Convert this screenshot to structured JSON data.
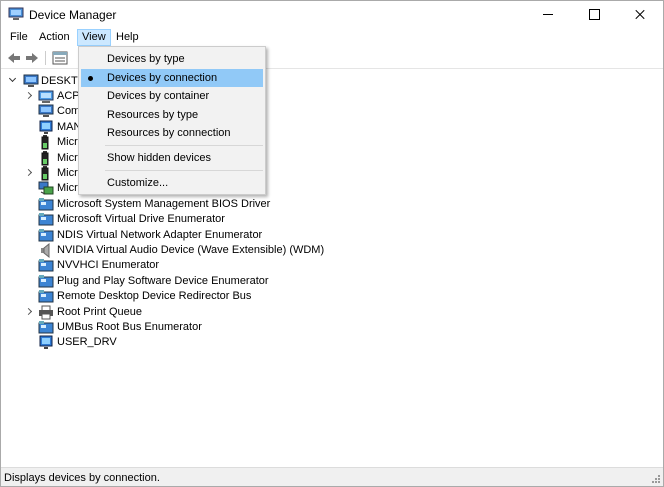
{
  "window": {
    "title": "Device Manager",
    "accent": "#cce8ff"
  },
  "menubar": {
    "file": "File",
    "action": "Action",
    "view": "View",
    "help": "Help"
  },
  "toolbar": {
    "back_icon": "arrow-left-icon",
    "forward_icon": "arrow-right-icon",
    "properties_icon": "properties-icon"
  },
  "tree": {
    "root": "DESKTO",
    "items": [
      {
        "label": "ACP",
        "icon": "acpi-icon",
        "expander": "collapsed"
      },
      {
        "label": "Com",
        "icon": "computer-icon",
        "expander": "none"
      },
      {
        "label": "MAN",
        "icon": "monitor-icon",
        "expander": "none"
      },
      {
        "label": "Micr",
        "icon": "battery-icon",
        "expander": "none"
      },
      {
        "label": "Micr",
        "icon": "battery-icon",
        "expander": "none"
      },
      {
        "label": "Micr",
        "icon": "battery-icon",
        "expander": "collapsed"
      },
      {
        "label": "Micr",
        "icon": "network-icon",
        "expander": "none"
      },
      {
        "label": "Microsoft System Management BIOS Driver",
        "icon": "system-device-icon",
        "expander": "none"
      },
      {
        "label": "Microsoft Virtual Drive Enumerator",
        "icon": "system-device-icon",
        "expander": "none"
      },
      {
        "label": "NDIS Virtual Network Adapter Enumerator",
        "icon": "system-device-icon",
        "expander": "none"
      },
      {
        "label": "NVIDIA Virtual Audio Device (Wave Extensible) (WDM)",
        "icon": "speaker-icon",
        "expander": "none"
      },
      {
        "label": "NVVHCI Enumerator",
        "icon": "system-device-icon",
        "expander": "none"
      },
      {
        "label": "Plug and Play Software Device Enumerator",
        "icon": "system-device-icon",
        "expander": "none"
      },
      {
        "label": "Remote Desktop Device Redirector Bus",
        "icon": "system-device-icon",
        "expander": "none"
      },
      {
        "label": "Root Print Queue",
        "icon": "printer-icon",
        "expander": "collapsed"
      },
      {
        "label": "UMBus Root Bus Enumerator",
        "icon": "system-device-icon",
        "expander": "none"
      },
      {
        "label": "USER_DRV",
        "icon": "monitor-icon",
        "expander": "none"
      }
    ]
  },
  "view_menu": {
    "items": [
      {
        "label": "Devices by type",
        "selected": false
      },
      {
        "label": "Devices by connection",
        "selected": true
      },
      {
        "label": "Devices by container",
        "selected": false
      },
      {
        "label": "Resources by type",
        "selected": false
      },
      {
        "label": "Resources by connection",
        "selected": false
      },
      {
        "label": "Show hidden devices",
        "selected": false
      },
      {
        "label": "Customize...",
        "selected": false
      }
    ]
  },
  "statusbar": {
    "text": "Displays devices by connection."
  }
}
